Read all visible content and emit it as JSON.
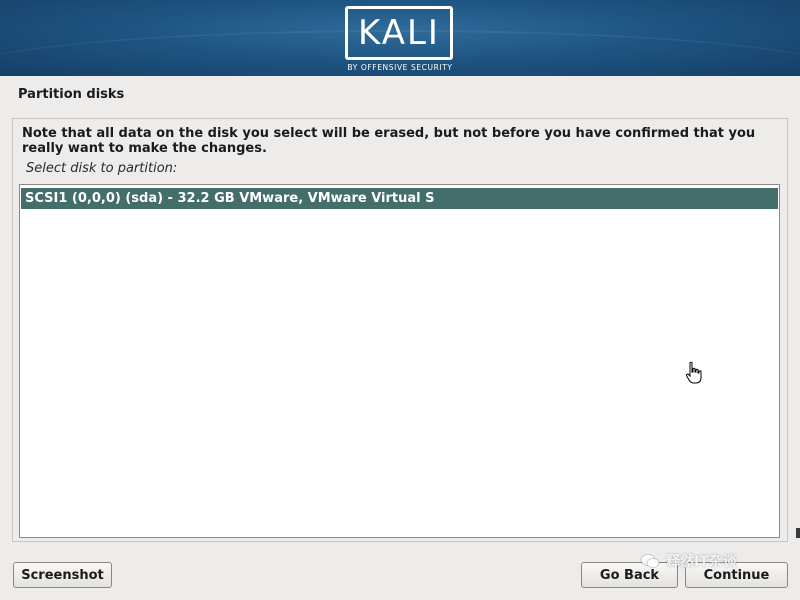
{
  "banner": {
    "logo_text": "KALI",
    "logo_subtitle": "BY OFFENSIVE SECURITY"
  },
  "page": {
    "title": "Partition disks",
    "note": "Note that all data on the disk you select will be erased, but not before you have confirmed that you really want to make the changes.",
    "prompt": "Select disk to partition:"
  },
  "disk_list": {
    "items": [
      {
        "label": "SCSI1 (0,0,0) (sda) - 32.2 GB VMware, VMware Virtual S",
        "selected": true
      }
    ]
  },
  "buttons": {
    "screenshot": "Screenshot",
    "go_back": "Go Back",
    "continue": "Continue"
  },
  "watermark": {
    "text": "释然IT杂谈"
  },
  "colors": {
    "banner": "#1f5583",
    "selected_row": "#436e69",
    "background": "#edeceb"
  },
  "icons": {
    "cursor": "hand-pointer-icon",
    "watermark": "wechat-icon"
  }
}
